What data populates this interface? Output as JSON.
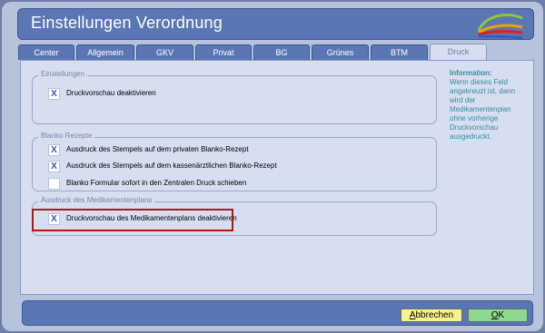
{
  "window": {
    "title": "Einstellungen Verordnung"
  },
  "tabs": [
    {
      "label": "Center",
      "active": false
    },
    {
      "label": "Allgemein",
      "active": false
    },
    {
      "label": "GKV",
      "active": false
    },
    {
      "label": "Privat",
      "active": false
    },
    {
      "label": "BG",
      "active": false
    },
    {
      "label": "Grünes",
      "active": false
    },
    {
      "label": "BTM",
      "active": false
    },
    {
      "label": "Druck",
      "active": true
    }
  ],
  "groups": {
    "einstellungen": {
      "legend": "Einstellungen",
      "items": [
        {
          "label": "Druckvorschau deaktivieren",
          "checked": true,
          "mark": "X"
        }
      ]
    },
    "blanko": {
      "legend": "Blanko Rezepte",
      "items": [
        {
          "label": "Ausdruck des Stempels auf dem privaten Blanko-Rezept",
          "checked": true,
          "mark": "X"
        },
        {
          "label": "Ausdruck des Stempels auf dem kassenärztlichen Blanko-Rezept",
          "checked": true,
          "mark": "X"
        },
        {
          "label": "Blanko Formular sofort in den Zentralen Druck schieben",
          "checked": false,
          "mark": ""
        }
      ]
    },
    "medikamentenplan": {
      "legend": "Ausdruck des Medikamentenplans",
      "items": [
        {
          "label": "Druckvorschau des Medikamentenplans deaktivieren",
          "checked": true,
          "mark": "X"
        }
      ]
    }
  },
  "info": {
    "title": "Information:",
    "lines": [
      "Wenn dieses Feld",
      "angekreuzt ist, dann",
      "wird der",
      "Medikamentenplan",
      "ohne vorherige",
      "Druckvorschau",
      "ausgedruckt."
    ]
  },
  "buttons": {
    "cancel": {
      "mnemonic": "A",
      "rest": "bbrechen"
    },
    "ok": {
      "mnemonic": "O",
      "rest": "K"
    }
  },
  "colors": {
    "titlebar": "#5b76b4",
    "panel": "#d6def0",
    "window": "#b7c3dc",
    "checkmark": "#3a4cc9",
    "info_text": "#3b8aa0",
    "highlight": "#b01818",
    "cancel_button": "#f7f38c",
    "ok_button": "#8fd98f"
  }
}
